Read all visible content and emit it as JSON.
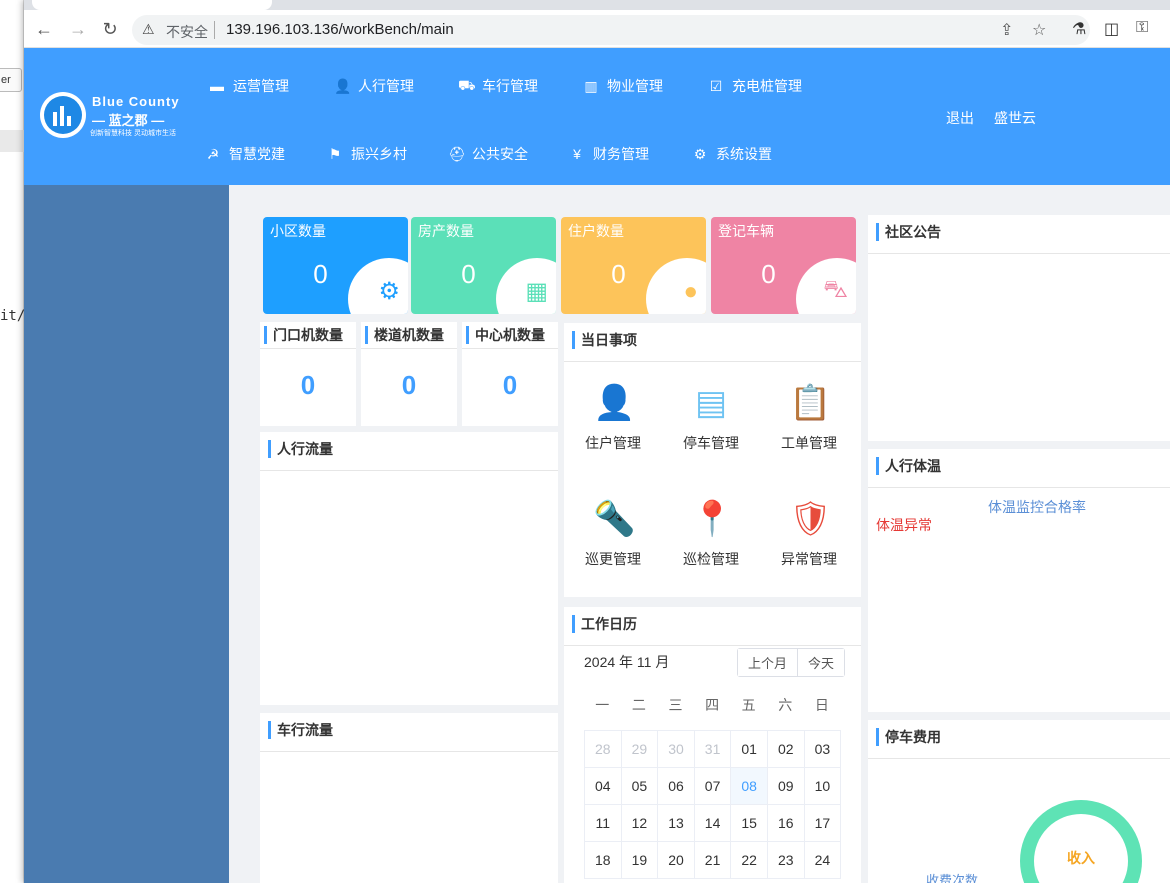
{
  "background": {
    "box_text": "er",
    "snippet": "it/"
  },
  "browser": {
    "insecure_label": "不安全",
    "url": "139.196.103.136/workBench/main"
  },
  "header": {
    "logo": {
      "title": "Blue County",
      "subtitle": "— 蓝之郡 —",
      "tagline": "创新智慧科技 灵动城市生活"
    },
    "menu_row1": [
      "运营管理",
      "人行管理",
      "车行管理",
      "物业管理",
      "充电桩管理"
    ],
    "menu_row2": [
      "智慧党建",
      "振兴乡村",
      "公共安全",
      "财务管理",
      "系统设置"
    ],
    "logout": "退出",
    "user": "盛世云"
  },
  "stats": [
    {
      "label": "小区数量",
      "value": "0",
      "color": "#1e9fff",
      "icon": "gear-icon"
    },
    {
      "label": "房产数量",
      "value": "0",
      "color": "#5be0b8",
      "icon": "building-icon"
    },
    {
      "label": "住户数量",
      "value": "0",
      "color": "#fdc45a",
      "icon": "resident-icon"
    },
    {
      "label": "登记车辆",
      "value": "0",
      "color": "#ef84a4",
      "icon": "car-icon"
    }
  ],
  "devices": [
    {
      "label": "门口机数量",
      "value": "0"
    },
    {
      "label": "楼道机数量",
      "value": "0"
    },
    {
      "label": "中心机数量",
      "value": "0"
    }
  ],
  "panels": {
    "people_flow": "人行流量",
    "vehicle_flow": "车行流量",
    "today_tasks": "当日事项",
    "work_calendar": "工作日历",
    "notice": "社区公告",
    "body_temp": "人行体温",
    "parking_fee": "停车费用"
  },
  "tasks": [
    {
      "label": "住户管理",
      "icon": "resident-manage-icon"
    },
    {
      "label": "停车管理",
      "icon": "parking-book-icon"
    },
    {
      "label": "工单管理",
      "icon": "clipboard-icon"
    },
    {
      "label": "巡更管理",
      "icon": "flashlight-icon"
    },
    {
      "label": "巡检管理",
      "icon": "location-pin-icon"
    },
    {
      "label": "异常管理",
      "icon": "alert-shield-icon"
    }
  ],
  "calendar": {
    "month_label": "2024 年 11 月",
    "prev_month": "上个月",
    "today": "今天",
    "weekdays": [
      "一",
      "二",
      "三",
      "四",
      "五",
      "六",
      "日"
    ],
    "days": [
      [
        "28",
        "29",
        "30",
        "31",
        "01",
        "02",
        "03"
      ],
      [
        "04",
        "05",
        "06",
        "07",
        "08",
        "09",
        "10"
      ],
      [
        "11",
        "12",
        "13",
        "14",
        "15",
        "16",
        "17"
      ],
      [
        "18",
        "19",
        "20",
        "21",
        "22",
        "23",
        "24"
      ]
    ],
    "today_day": "08"
  },
  "temperature": {
    "abnormal": "体温异常",
    "pass_rate": "体温监控合格率"
  },
  "parking": {
    "ring_label": "收入",
    "count_label": "收费次数"
  }
}
